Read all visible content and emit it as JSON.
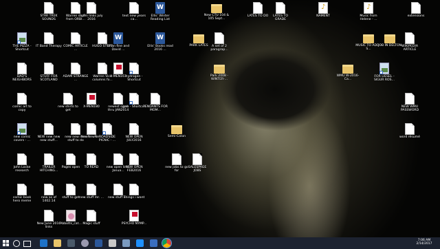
{
  "desktop_icons": [
    {
      "id": "star-trek-sounds",
      "label": "STAR TREK SOUNDS",
      "kind": "doc"
    },
    {
      "id": "warren-stuff",
      "label": "Warren stuff from ORBI...",
      "kind": "doc"
    },
    {
      "id": "open-links",
      "label": "open links july 2016",
      "kind": "doc"
    },
    {
      "id": "text-new-years",
      "label": "text new years ca...",
      "kind": "doc"
    },
    {
      "id": "ellis-winter",
      "label": "Ellis' Winter Reading List",
      "kind": "word"
    },
    {
      "id": "new-ctu",
      "label": "New CTU 104 & 105 Sept...",
      "kind": "folder"
    },
    {
      "id": "lates-to-do",
      "label": "LATES TO DO",
      "kind": "doc"
    },
    {
      "id": "lates-to-grade",
      "label": "LATES TO GRADE",
      "kind": "doc"
    },
    {
      "id": "nament",
      "label": "NAMENT",
      "kind": "music"
    },
    {
      "id": "music-helene",
      "label": "Music from Helene - ...",
      "kind": "music"
    },
    {
      "id": "extensions",
      "label": "extensions",
      "kind": "doc"
    },
    {
      "id": "pizza-shortcut",
      "label": "THE PIZZA - Shortcut",
      "kind": "shortcut-img"
    },
    {
      "id": "it-band",
      "label": "IT Band Therapy",
      "kind": "doc"
    },
    {
      "id": "comic-article",
      "label": "COMIC ARTICLE ...",
      "kind": "doc"
    },
    {
      "id": "hugo-stuff",
      "label": "HUGO STUFF",
      "kind": "doc"
    },
    {
      "id": "brian-fine",
      "label": "Brian fine and David ...",
      "kind": "word"
    },
    {
      "id": "ellis-books",
      "label": "Ellis' Books read 2016 ...",
      "kind": "word"
    },
    {
      "id": "park-lates",
      "label": "PARK LATES",
      "kind": "folder"
    },
    {
      "id": "a-set-of",
      "label": "A set of 2 paragrap...",
      "kind": "doc"
    },
    {
      "id": "music-to-add",
      "label": "MUSIC TO ADD - S...",
      "kind": "folder"
    },
    {
      "id": "job-delton",
      "label": "JOB IN DELTON",
      "kind": "folder"
    },
    {
      "id": "wikipedia-article",
      "label": "WIKIPEDIA ARTICLE",
      "kind": "doc"
    },
    {
      "id": "dads-neighbors",
      "label": "DAD'S NEIGHBORS",
      "kind": "doc"
    },
    {
      "id": "stuff-scotland",
      "label": "STUFF FOR SCOTLAND",
      "kind": "doc"
    },
    {
      "id": "adam-strange",
      "label": "ADAM STRANGE ...",
      "kind": "doc"
    },
    {
      "id": "warren-vice",
      "label": "Warren Vice columns fo...",
      "kind": "doc"
    },
    {
      "id": "x-men-161",
      "label": "X-MEN161",
      "kind": "pdf"
    },
    {
      "id": "hydrogen",
      "label": "hydrogen - Shortcut",
      "kind": "shortcut"
    },
    {
      "id": "park-2008",
      "label": "Park 2008 - WINTER-...",
      "kind": "folder"
    },
    {
      "id": "wmu-winter",
      "label": "WMU W-2016-Ca...",
      "kind": "folder"
    },
    {
      "id": "for-liesel",
      "label": "FOR LIESEL - SIGUR ROS...",
      "kind": "shortcut-img"
    },
    {
      "id": "comic-art-copy",
      "label": "comic art to copy",
      "kind": "doc"
    },
    {
      "id": "new-shirts",
      "label": "new shirts to get",
      "kind": "doc"
    },
    {
      "id": "x-men-180",
      "label": "X-MEN180",
      "kind": "pdf"
    },
    {
      "id": "newest-open",
      "label": "newest open thru JAN2014",
      "kind": "doc"
    },
    {
      "id": "gab-shortcut",
      "label": "gab - Shortcut",
      "kind": "shortcut"
    },
    {
      "id": "pendants",
      "label": "PENDANTS FOR MOM...",
      "kind": "doc"
    },
    {
      "id": "new-wmu-password",
      "label": "NEW WMU PASSWORD",
      "kind": "doc"
    },
    {
      "id": "new-comic-covers",
      "label": "new comic covers - ...",
      "kind": "shortcut-img"
    },
    {
      "id": "new-new-stuff",
      "label": "NEW new new new stuff...",
      "kind": "doc"
    },
    {
      "id": "new-new-stuff-do",
      "label": "new new new stuff to do",
      "kind": "doc"
    },
    {
      "id": "new-new-new-new",
      "label": "NewNewNe...",
      "kind": "doc"
    },
    {
      "id": "roadside-picnic",
      "label": "ROADSIDE PICNIC - ...",
      "kind": "shortcut"
    },
    {
      "id": "new-open-july",
      "label": "NEW OPEN JULY2016",
      "kind": "doc"
    },
    {
      "id": "semi-colon",
      "label": "Semi-Colon",
      "kind": "folder"
    },
    {
      "id": "word-resume",
      "label": "word résumé",
      "kind": "doc"
    },
    {
      "id": "john-locke",
      "label": "John Locke research",
      "kind": "doc"
    },
    {
      "id": "trailer-hitching",
      "label": "TRAILER HITCHING...",
      "kind": "doc"
    },
    {
      "id": "pages-open",
      "label": "Pages open",
      "kind": "doc"
    },
    {
      "id": "to-read",
      "label": "TO READ",
      "kind": "doc"
    },
    {
      "id": "new-open-links",
      "label": "new open links Janua...",
      "kind": "doc"
    },
    {
      "id": "new-open-feb",
      "label": "NEW OPEN FEB2016",
      "kind": "doc"
    },
    {
      "id": "new-jobs",
      "label": "new jobs to go for",
      "kind": "doc"
    },
    {
      "id": "salespage-jobs",
      "label": "SALESPAGE JOBS",
      "kind": "doc"
    },
    {
      "id": "comic-book-hero",
      "label": "comic book hero meme",
      "kind": "doc"
    },
    {
      "id": "new-as-of",
      "label": "new as of 1402.14",
      "kind": "doc"
    },
    {
      "id": "stuff-to-get",
      "label": "stuff to get",
      "kind": "doc"
    },
    {
      "id": "new-stuff-mr",
      "label": "new stuff mr. ...",
      "kind": "doc"
    },
    {
      "id": "new-stuff-n",
      "label": "new stuff n...",
      "kind": "doc"
    },
    {
      "id": "things-i-want",
      "label": "Things i want",
      "kind": "doc"
    },
    {
      "id": "new-june",
      "label": "New June 2016 links",
      "kind": "doc"
    },
    {
      "id": "abbotts-cat",
      "label": "Abbotts_cat...",
      "kind": "pinkfile"
    },
    {
      "id": "magic-stuff",
      "label": "Magic stuff",
      "kind": "doc"
    },
    {
      "id": "psycho-nymp",
      "label": "PSYCHO NYMP...",
      "kind": "pdf"
    }
  ],
  "taskbar": {
    "clock_time": "7:06 AM",
    "clock_date": "2/14/2017"
  }
}
